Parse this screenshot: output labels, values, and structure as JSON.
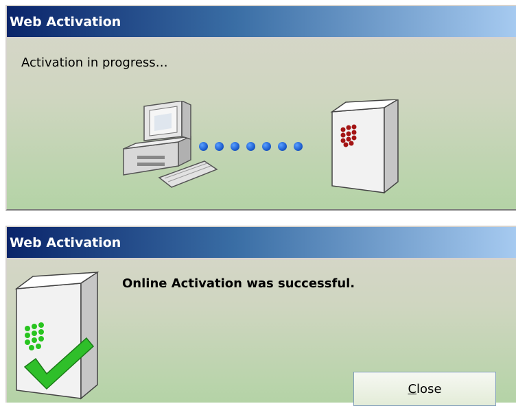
{
  "dialog1": {
    "title": "Web Activation",
    "status": "Activation in progress…",
    "icons": [
      "computer-icon",
      "server-icon"
    ],
    "progress_dots": 7,
    "dot_color": "#1e5fd0"
  },
  "dialog2": {
    "title": "Web Activation",
    "message": "Online Activation was successful.",
    "close_button": {
      "mnemonic": "C",
      "rest": "lose"
    },
    "icons": [
      "server-success-icon"
    ],
    "check_color": "#22c41f"
  },
  "colors": {
    "titlebar_start": "#0a246a",
    "titlebar_end": "#a6caf0",
    "body_bottom": "#b4d3a6"
  }
}
